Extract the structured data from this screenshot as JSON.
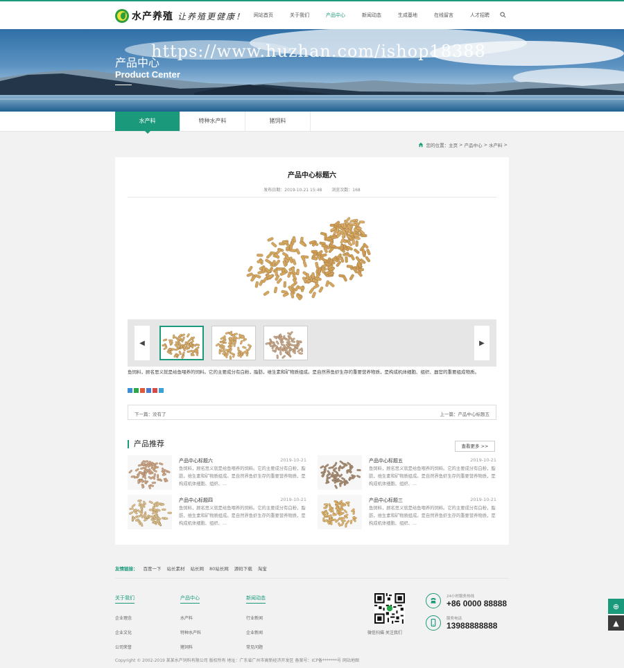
{
  "colors": {
    "accent": "#1a9a7a",
    "footer_bg": "#f2f2f2"
  },
  "header": {
    "logo_name": "水产养殖",
    "logo_slogan": "让养殖更健康！",
    "nav": [
      "网站首页",
      "关于我们",
      "产品中心",
      "新闻动态",
      "生成基地",
      "在线留言",
      "人才招聘"
    ],
    "active_nav": 2,
    "search_icon": "search-icon"
  },
  "banner": {
    "title_cn": "产品中心",
    "title_en": "Product Center",
    "watermark": "https://www.huzhan.com/ishop18388"
  },
  "subnav": {
    "tabs": [
      "水产料",
      "特种水产料",
      "猪饲料"
    ],
    "active": 0
  },
  "breadcrumb": {
    "prefix": "您的位置：",
    "items": [
      "主页",
      "产品中心",
      "水产料"
    ],
    "separator": ">"
  },
  "article": {
    "title": "产品中心标题六",
    "date": "发布日期：2019-10-21 15:48",
    "views": "浏览次数：168",
    "description": "鱼饲料，顾名思义就是给鱼喂养的饲料。它的主要成分有白粉，脂肪，维生素和矿物质组成。是自然界鱼虾生存的重要营养物质，是构成机体细胞、组织、器官的重要组成物质。",
    "gallery_thumbs": 3,
    "gallery_active": 0,
    "prev": "下一篇：没有了",
    "next": "上一篇：产品中心标题五"
  },
  "recommend": {
    "heading": "产品推荐",
    "more": "查看更多 >>",
    "items": [
      {
        "title": "产品中心标题六",
        "date": "2019-10-21",
        "text": "鱼饲料，顾名思义就是给鱼喂养的饲料。它的主要成分有白粉，脂肪，维生素和矿物质组成。是自然界鱼虾生存的重要营养物质，是构成机体细胞、组织、..."
      },
      {
        "title": "产品中心标题五",
        "date": "2019-10-21",
        "text": "鱼饲料，顾名思义就是给鱼喂养的饲料。它的主要成分有白粉，脂肪，维生素和矿物质组成。是自然界鱼虾生存的重要营养物质，是构成机体细胞、组织、..."
      },
      {
        "title": "产品中心标题四",
        "date": "2019-10-21",
        "text": "鱼饲料，顾名思义就是给鱼喂养的饲料。它的主要成分有白粉，脂肪，维生素和矿物质组成。是自然界鱼虾生存的重要营养物质，是构成机体细胞、组织、..."
      },
      {
        "title": "产品中心标题三",
        "date": "2019-10-21",
        "text": "鱼饲料，顾名思义就是给鱼喂养的饲料。它的主要成分有白粉，脂肪，维生素和矿物质组成。是自然界鱼虾生存的重要营养物质，是构成机体细胞、组织、..."
      }
    ]
  },
  "footer": {
    "friends_label": "友情链接：",
    "friends": [
      "百度一下",
      "站长素材",
      "站长网",
      "80站长网",
      "源码下载",
      "淘宝"
    ],
    "columns": [
      {
        "title": "关于我们",
        "items": [
          "企业理念",
          "企业文化",
          "公司荣誉"
        ]
      },
      {
        "title": "产品中心",
        "items": [
          "水产料",
          "特种水产料",
          "猪饲料"
        ]
      },
      {
        "title": "新闻动态",
        "items": [
          "行业新闻",
          "企业新闻",
          "常见问题"
        ]
      }
    ],
    "qr_caption": "微信扫描 关注我们",
    "phone_label": "24小时服务热线",
    "phone": "+86 0000 88888",
    "mobile_label": "服务电话",
    "mobile": "13988888888",
    "copyright": "Copyright © 2002-2019 某某水产饲料有限公司 版权所有   地址：广东省广州市高新经济开发区   备案号：ICP备*******号   网站地图"
  }
}
